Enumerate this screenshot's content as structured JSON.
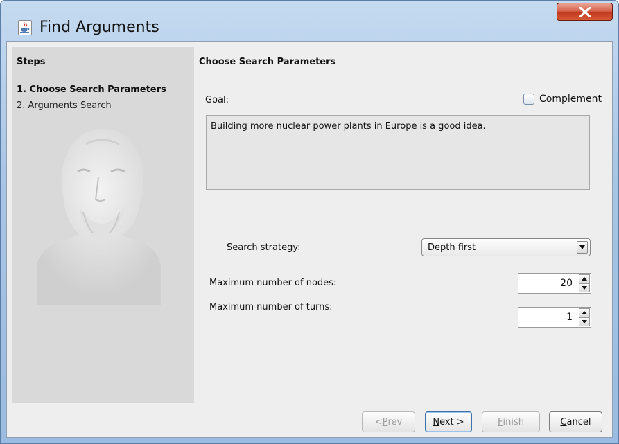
{
  "window": {
    "title": "Find Arguments",
    "icons": {
      "app": "java-cup-icon",
      "close": "close-x-icon"
    }
  },
  "steps": {
    "header": "Steps",
    "items": [
      {
        "label": "1. Choose Search Parameters",
        "active": true
      },
      {
        "label": "2. Arguments Search",
        "active": false
      }
    ],
    "image": "philosopher-bust-image"
  },
  "panel": {
    "title": "Choose Search Parameters",
    "goal_label": "Goal:",
    "complement_label": "Complement",
    "complement_checked": false,
    "goal_text": "Building more nuclear power plants in Europe is a good idea."
  },
  "params": {
    "strategy_label": "Search strategy:",
    "strategy_value": "Depth first",
    "max_nodes_label": "Maximum number of nodes:",
    "max_nodes_value": "20",
    "max_turns_label": "Maximum number of turns:",
    "max_turns_value": "1"
  },
  "buttons": {
    "prev": {
      "prefix": "< ",
      "mnemonic": "P",
      "rest": "rev"
    },
    "next": {
      "mnemonic": "N",
      "rest": "ext >"
    },
    "finish": {
      "mnemonic": "F",
      "rest": "inish"
    },
    "cancel": {
      "mnemonic": "C",
      "rest": "ancel"
    }
  },
  "colors": {
    "title_gradient": "#a9c5e4",
    "close_button": "#c23a1f",
    "dialog_bg": "#eeeeee",
    "steps_bg": "#d9d9d9",
    "goal_bg": "#e6e6e6"
  }
}
